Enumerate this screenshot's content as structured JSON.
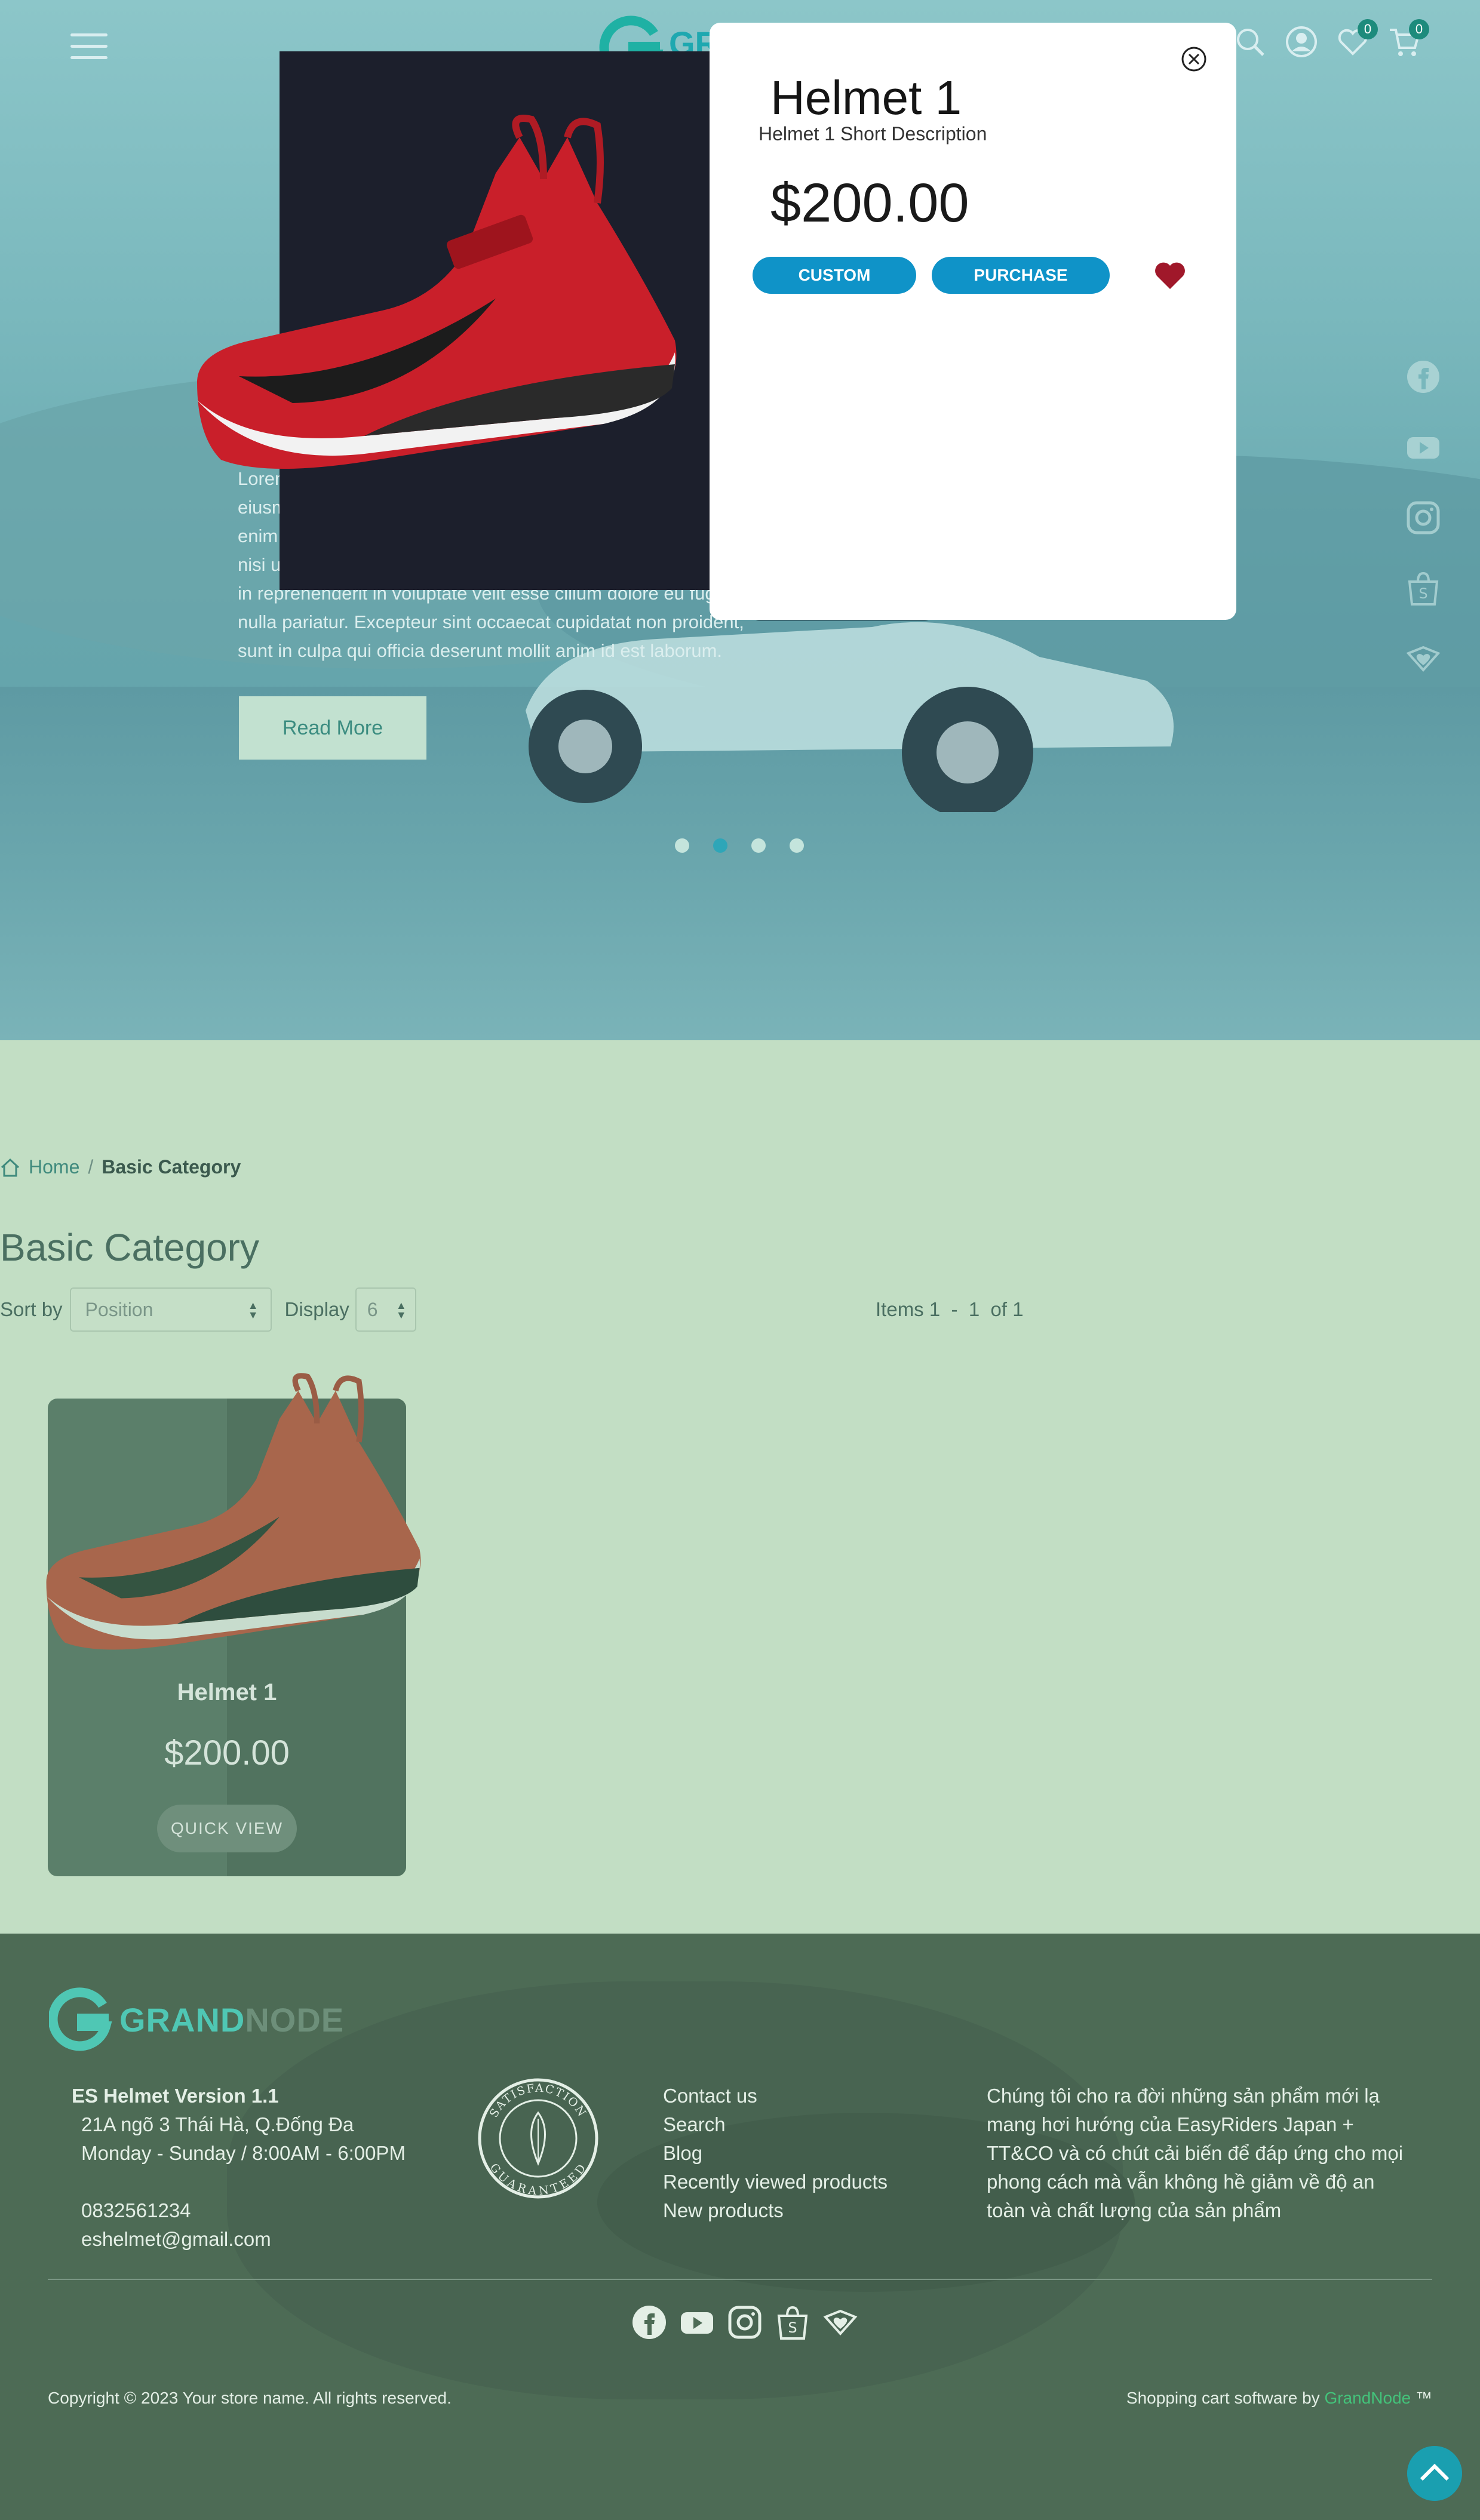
{
  "header": {
    "logo_text": "G",
    "wishlist_count": "0",
    "cart_count": "0",
    "icons": [
      "menu-icon",
      "search-icon",
      "user-icon",
      "heart-icon",
      "cart-icon"
    ]
  },
  "hero": {
    "big_letter": "G",
    "text": "Lorem ipsum dolor sit amet, consectetur adipiscing elit, sed do eiusmod tempor incididunt ut labore et dolore magna aliqua. Ut enim ad minim veniam, quis nostrud exercitation ullamco laboris nisi ut aliquip ex ea commodo consequat. Duis aute irure dolor in reprehenderit in voluptate velit esse cillum dolore eu fugiat nulla pariatur. Excepteur sint occaecat cupidatat non proident, sunt in culpa qui officia deserunt mollit anim id est laborum.",
    "read_more": "Read More",
    "slide_count": 4,
    "active_slide": 2
  },
  "quick_view": {
    "title": "Helmet 1",
    "short_description": "Helmet 1 Short Description",
    "price": "$200.00",
    "custom_label": "CUSTOM",
    "purchase_label": "PURCHASE"
  },
  "breadcrumb": {
    "home": "Home",
    "separator": "/",
    "current": "Basic Category"
  },
  "category": {
    "title": "Basic Category",
    "sort_label": "Sort by",
    "sort_value": "Position",
    "display_label": "Display",
    "display_value": "6",
    "items_info": "Items 1  -  1  of 1"
  },
  "products": [
    {
      "name": "Helmet 1",
      "price": "$200.00",
      "button": "QUICK VIEW"
    }
  ],
  "footer": {
    "logo_text_a": "GRAND",
    "logo_text_b": "NODE",
    "store_name": "ES Helmet Version 1.1",
    "address": "21A ngõ 3 Thái Hà, Q.Đống Đa",
    "hours": "Monday - Sunday / 8:00AM - 6:00PM",
    "phone": "0832561234",
    "email": "eshelmet@gmail.com",
    "seal_top": "SATISFACTION",
    "seal_bottom": "GUARANTEED",
    "links": [
      "Contact us",
      "Search",
      "Blog",
      "Recently viewed products",
      "New products"
    ],
    "about": "Chúng tôi cho ra đời những sản phẩm mới lạ mang hơi hướng của EasyRiders Japan + TT&CO và có chút cải biến để đáp ứng cho mọi phong cách mà vẫn không hề giảm về độ an toàn và chất lượng của sản phẩm",
    "copyright": "Copyright © 2023 Your store name. All rights reserved.",
    "powered_prefix": "Shopping cart software by",
    "powered_brand": "GrandNode",
    "powered_suffix": " ™"
  },
  "colors": {
    "accent": "#0f93c8",
    "hero_teal": "#7ab8bd",
    "page_green": "#c2dec4",
    "footer_green": "#4d6b55",
    "heart_red": "#a0182a"
  }
}
